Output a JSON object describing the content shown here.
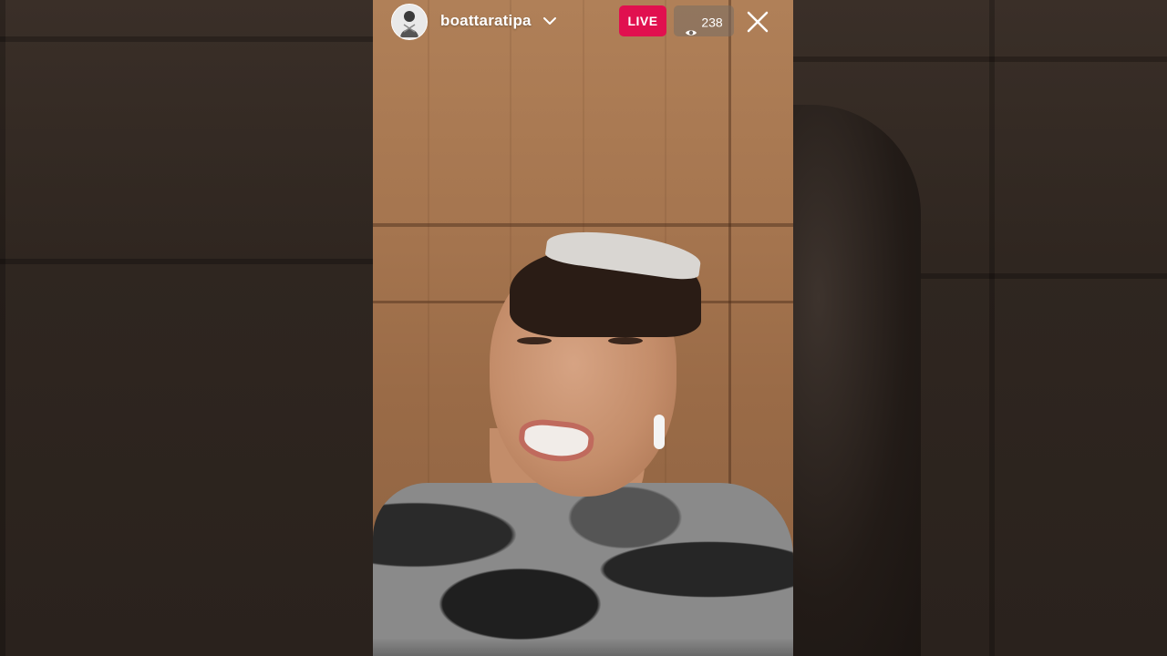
{
  "stream": {
    "username": "boattaratipa",
    "live_label": "LIVE",
    "viewer_count": "238"
  },
  "icons": {
    "avatar": "profile-avatar",
    "chevron": "chevron-down-icon",
    "viewers": "eye-icon",
    "close": "close-icon"
  },
  "colors": {
    "live_badge": "#e1104f",
    "viewer_badge": "#7a6e64",
    "text": "#ffffff"
  }
}
